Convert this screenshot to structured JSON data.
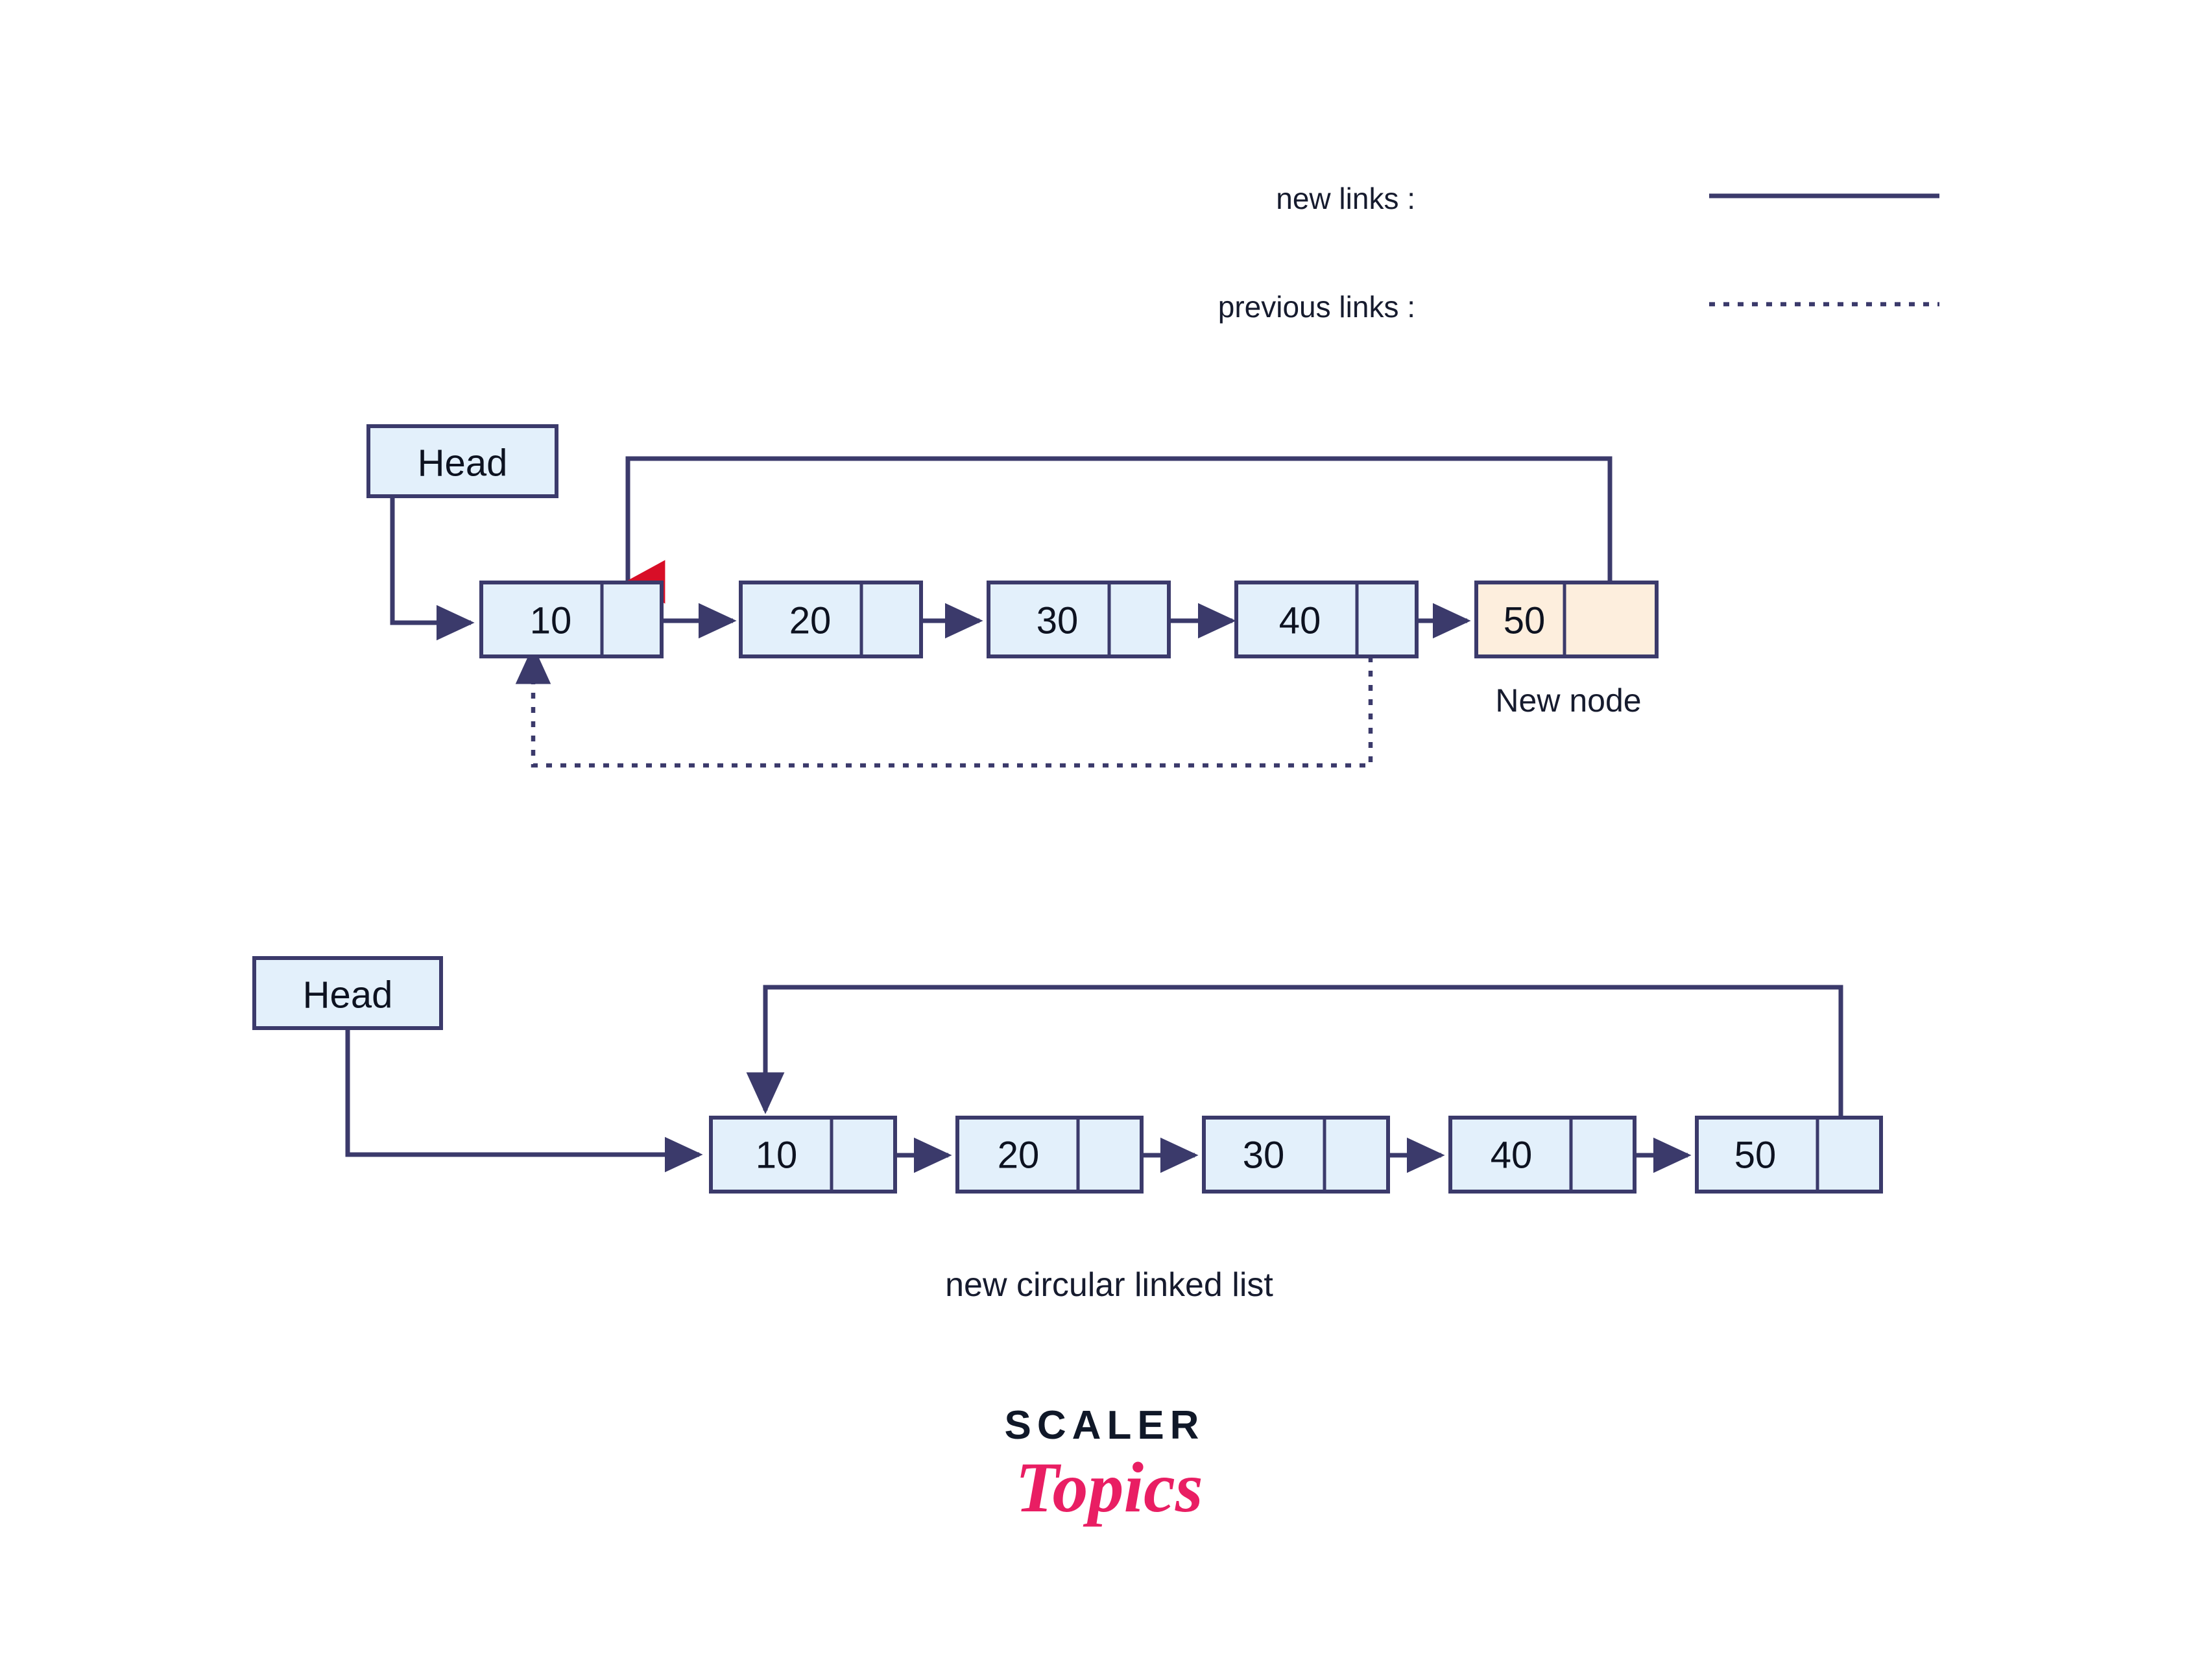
{
  "colors": {
    "stroke_navy": "#3b3a6b",
    "stroke_navy_dark": "#343366",
    "node_fill_blue": "#e3f0fb",
    "node_fill_cream": "#fdeedd",
    "arrow_red": "#d80e27",
    "text_dark": "#0d1220",
    "logo_dark": "#101828",
    "logo_pink": "#e91e63",
    "background": "#ffffff"
  },
  "legend": {
    "items": [
      {
        "label": "new links :",
        "style": "solid"
      },
      {
        "label": "previous links :",
        "style": "dotted"
      }
    ]
  },
  "diagram_top": {
    "head_label": "Head",
    "nodes": [
      {
        "value": "10",
        "fill": "blue"
      },
      {
        "value": "20",
        "fill": "blue"
      },
      {
        "value": "30",
        "fill": "blue"
      },
      {
        "value": "40",
        "fill": "blue"
      },
      {
        "value": "50",
        "fill": "cream"
      }
    ],
    "new_node_label": "New node"
  },
  "diagram_bottom": {
    "head_label": "Head",
    "nodes": [
      {
        "value": "10",
        "fill": "blue"
      },
      {
        "value": "20",
        "fill": "blue"
      },
      {
        "value": "30",
        "fill": "blue"
      },
      {
        "value": "40",
        "fill": "blue"
      },
      {
        "value": "50",
        "fill": "blue"
      }
    ],
    "caption": "new circular linked list"
  },
  "logo": {
    "word_top": "SCALER",
    "word_bottom": "Topics"
  }
}
